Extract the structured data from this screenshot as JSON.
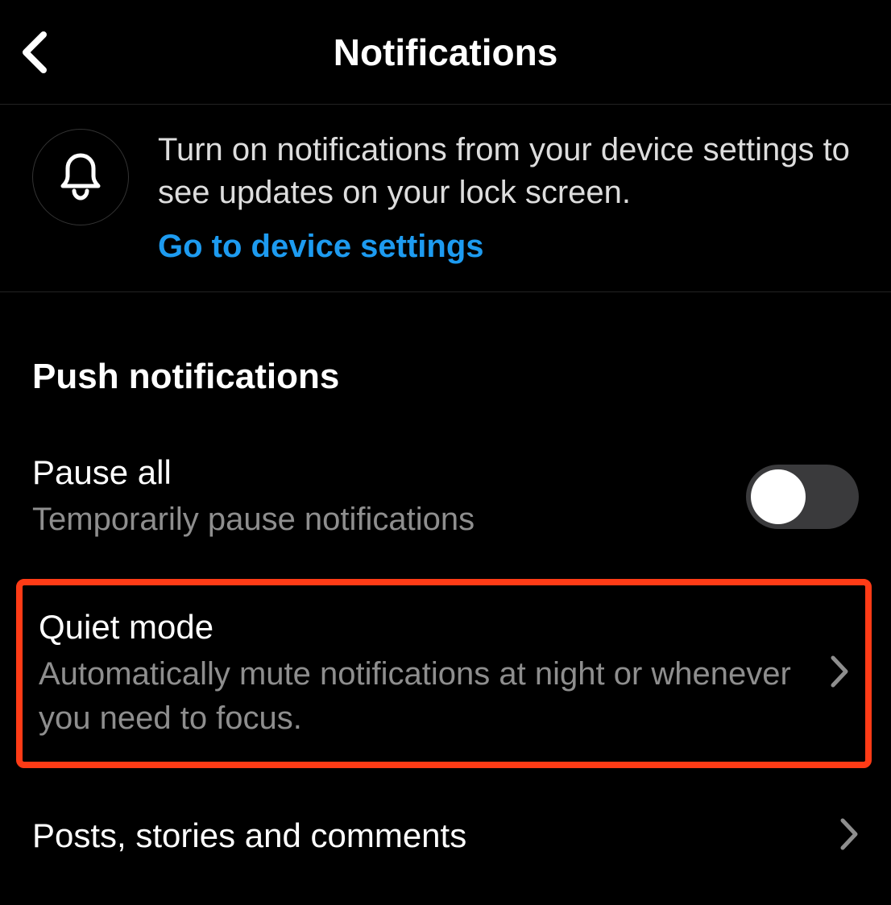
{
  "header": {
    "title": "Notifications"
  },
  "banner": {
    "text": "Turn on notifications from your device settings to see updates on your lock screen.",
    "link": "Go to device settings"
  },
  "push": {
    "section_title": "Push notifications",
    "pause": {
      "title": "Pause all",
      "subtitle": "Temporarily pause notifications",
      "enabled": false
    },
    "quiet": {
      "title": "Quiet mode",
      "subtitle": "Automatically mute notifications at night or whenever you need to focus."
    },
    "posts": {
      "title": "Posts, stories and comments"
    }
  }
}
